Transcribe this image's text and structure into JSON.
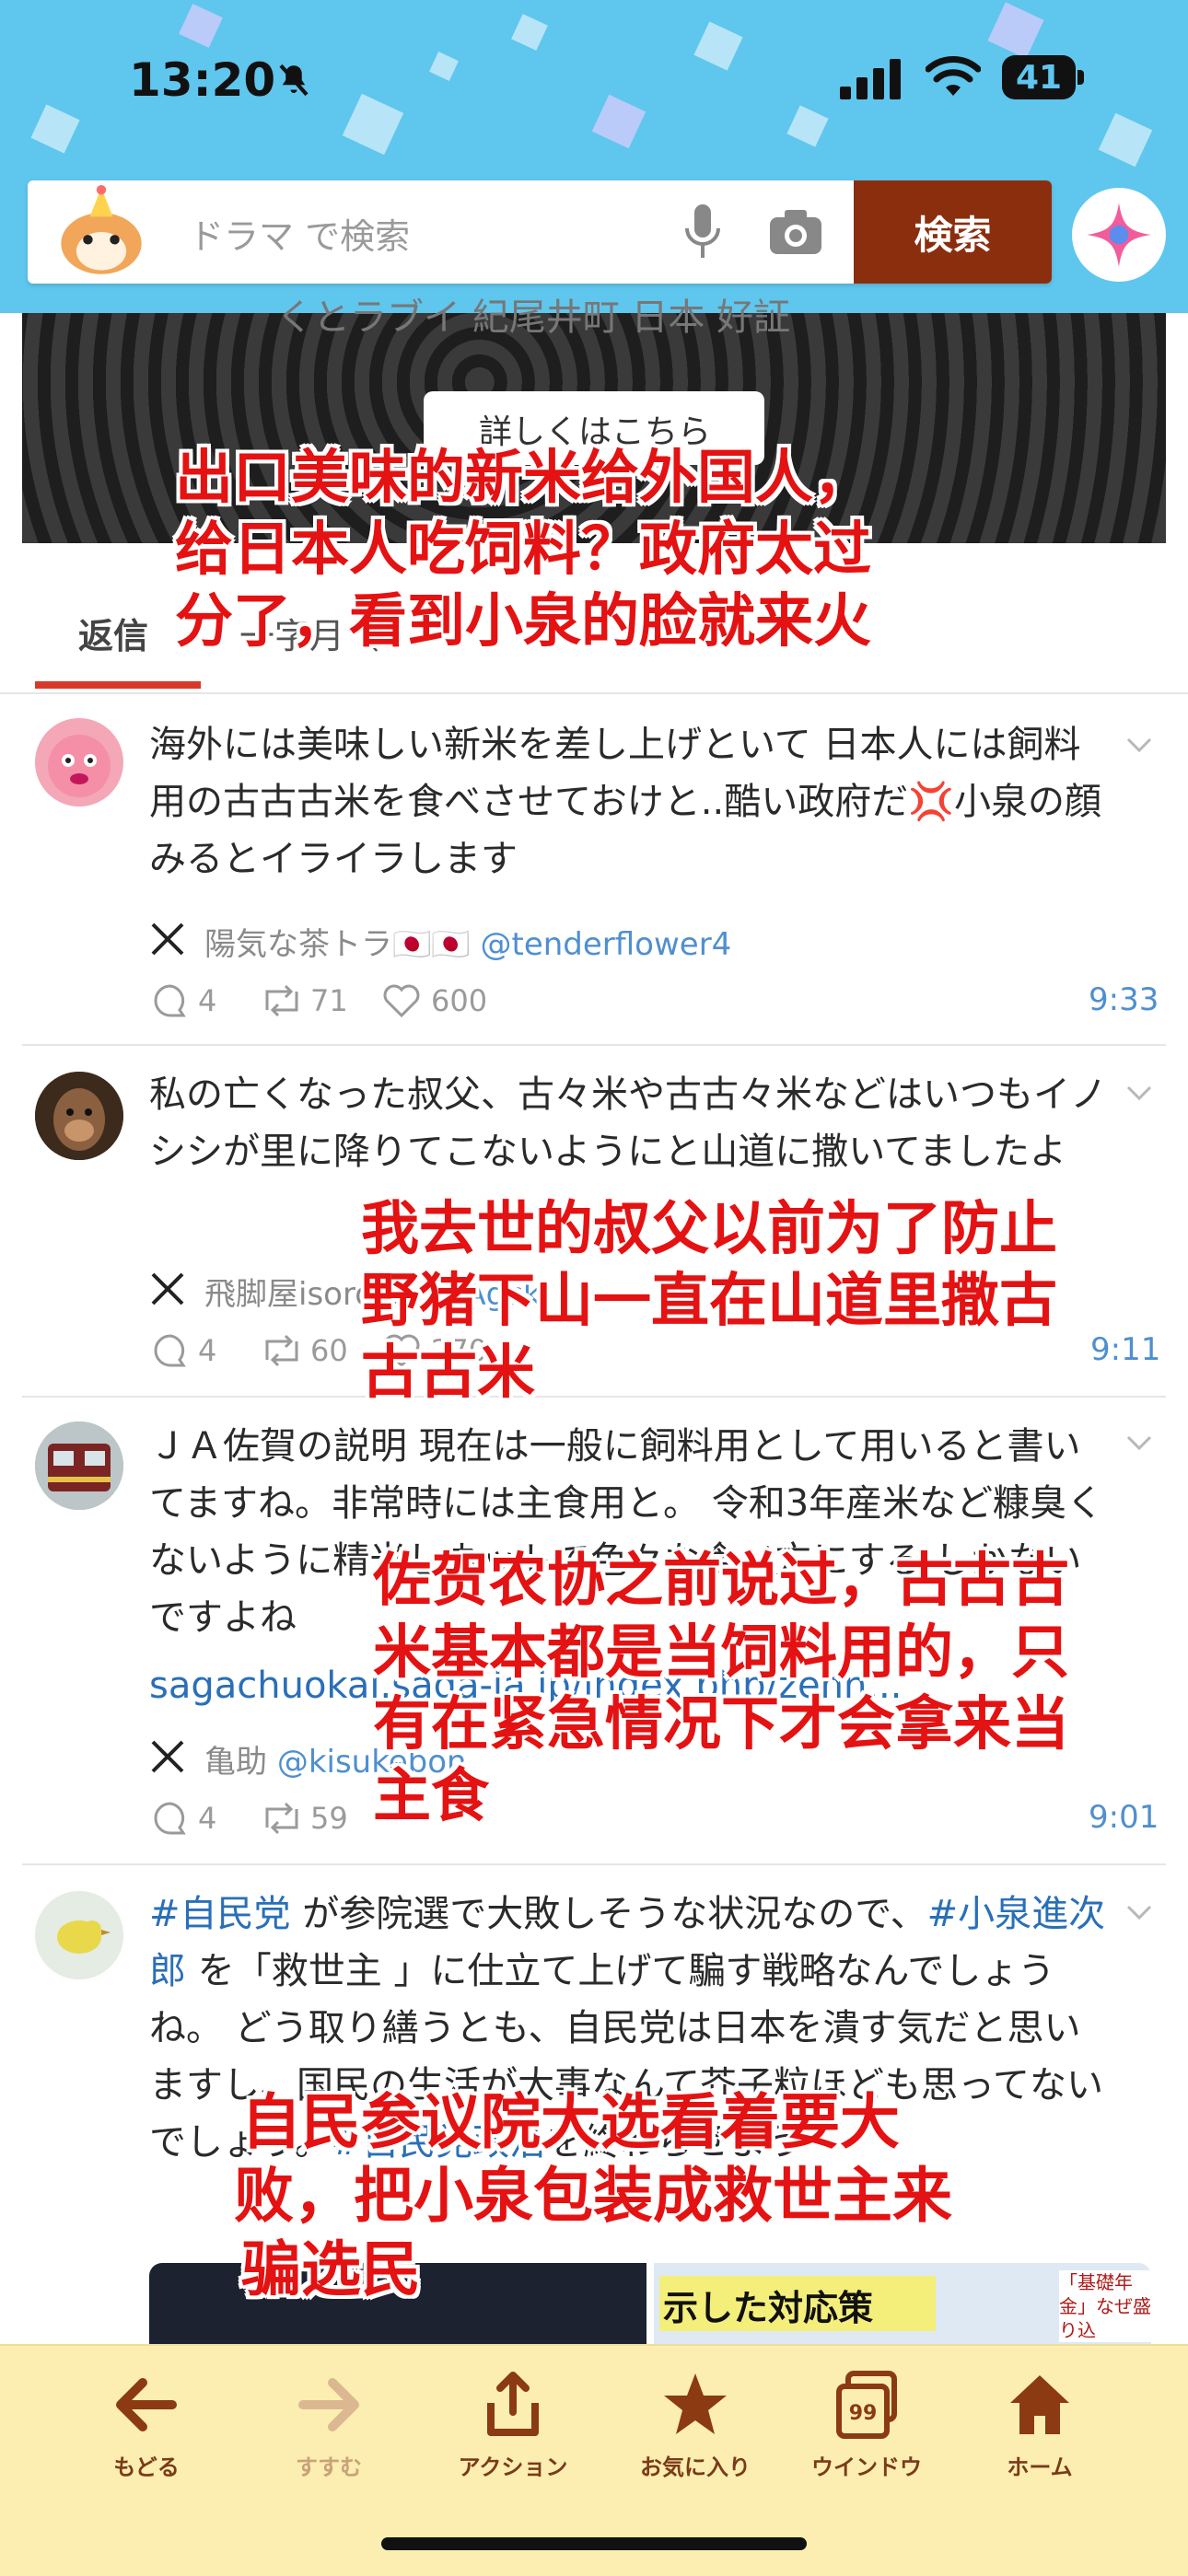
{
  "status_bar": {
    "time": "13:20",
    "battery": "41"
  },
  "search": {
    "placeholder": "ドラマ で検索",
    "button": "検索"
  },
  "banner": {
    "partial_text": "くとラブイ 紀尾井町 日本 好証",
    "button_label": "詳しくはこちら"
  },
  "tabs": {
    "reply": "返信",
    "second": "一字月（1"
  },
  "posts": [
    {
      "text": "海外には美味しい新米を差し上げといて 日本人には飼料用の古古古米を食べさせておけと..酷い政府だ💢小泉の顔みるとイライラします",
      "author": "陽気な茶トラ🇯🇵🇯🇵",
      "handle": "@tenderflower4",
      "replies": "4",
      "reposts": "71",
      "likes": "600",
      "time": "9:33"
    },
    {
      "text": "私の亡くなった叔父、古々米や古古々米などはいつもイノシシが里に降りてこないようにと山道に撒いてましたよ",
      "author": "飛脚屋isoroku",
      "handle": "@tAgck",
      "replies": "4",
      "reposts": "60",
      "likes": "270",
      "time": "9:11"
    },
    {
      "text": "ＪＡ佐賀の説明 現在は一般に飼料用として用いると書いてますね。非常時には主食用と。 令和3年産米など糠臭くないように精米しネットで色々な食べ方にする しかないですよね",
      "link": "sagachuokai.saga-ja.jp/index.php/zenn...",
      "author": "亀助",
      "handle": "@kisukebon",
      "replies": "4",
      "reposts": "59",
      "time": "9:01"
    },
    {
      "hashtag1": "#自民党",
      "text_a": " が参院選で大敗しそうな状況なので、",
      "hashtag2": "#小泉進次郎",
      "text_b": " を「救世主 」に仕立て上げて騙す戦略なんでしょうね。 どう取り繕うとも、自民党は日本を潰す気だと思いますし、国民の生活が大事なんて芥子粒ほども思ってないでしょう。",
      "hashtag3": "#自民党政治",
      "text_c": "を終わらせよう",
      "thumb_caption": "示した対応策",
      "thumb_right": "「基礎年金」なぜ盛り込"
    }
  ],
  "overlays": {
    "o1": [
      "出口美味的新米给外国人，",
      "给日本人吃饲料？政府太过",
      "分了，看到小泉的脸就来火"
    ],
    "o2": [
      "我去世的叔父以前为了防止",
      "野猪下山一直在山道里撒古",
      "古古米"
    ],
    "o3": [
      "佐贺农协之前说过，古古古",
      "米基本都是当饲料用的，只",
      "有在紧急情况下才会拿来当",
      "主食"
    ],
    "o4": [
      "自民参议院大选看着要大",
      "败，把小泉包装成救世主来",
      "骗选民"
    ]
  },
  "toolbar": {
    "back": "もどる",
    "forward": "すすむ",
    "action": "アクション",
    "favorites": "お気に入り",
    "windows": "ウインドウ",
    "windows_count": "99",
    "home": "ホーム"
  },
  "colors": {
    "header_bg": "#5fc6ee",
    "search_btn": "#8b2e0e",
    "overlay_text": "#e41212",
    "toolbar_bg": "#fbeeb0",
    "link": "#2a6fb8"
  }
}
